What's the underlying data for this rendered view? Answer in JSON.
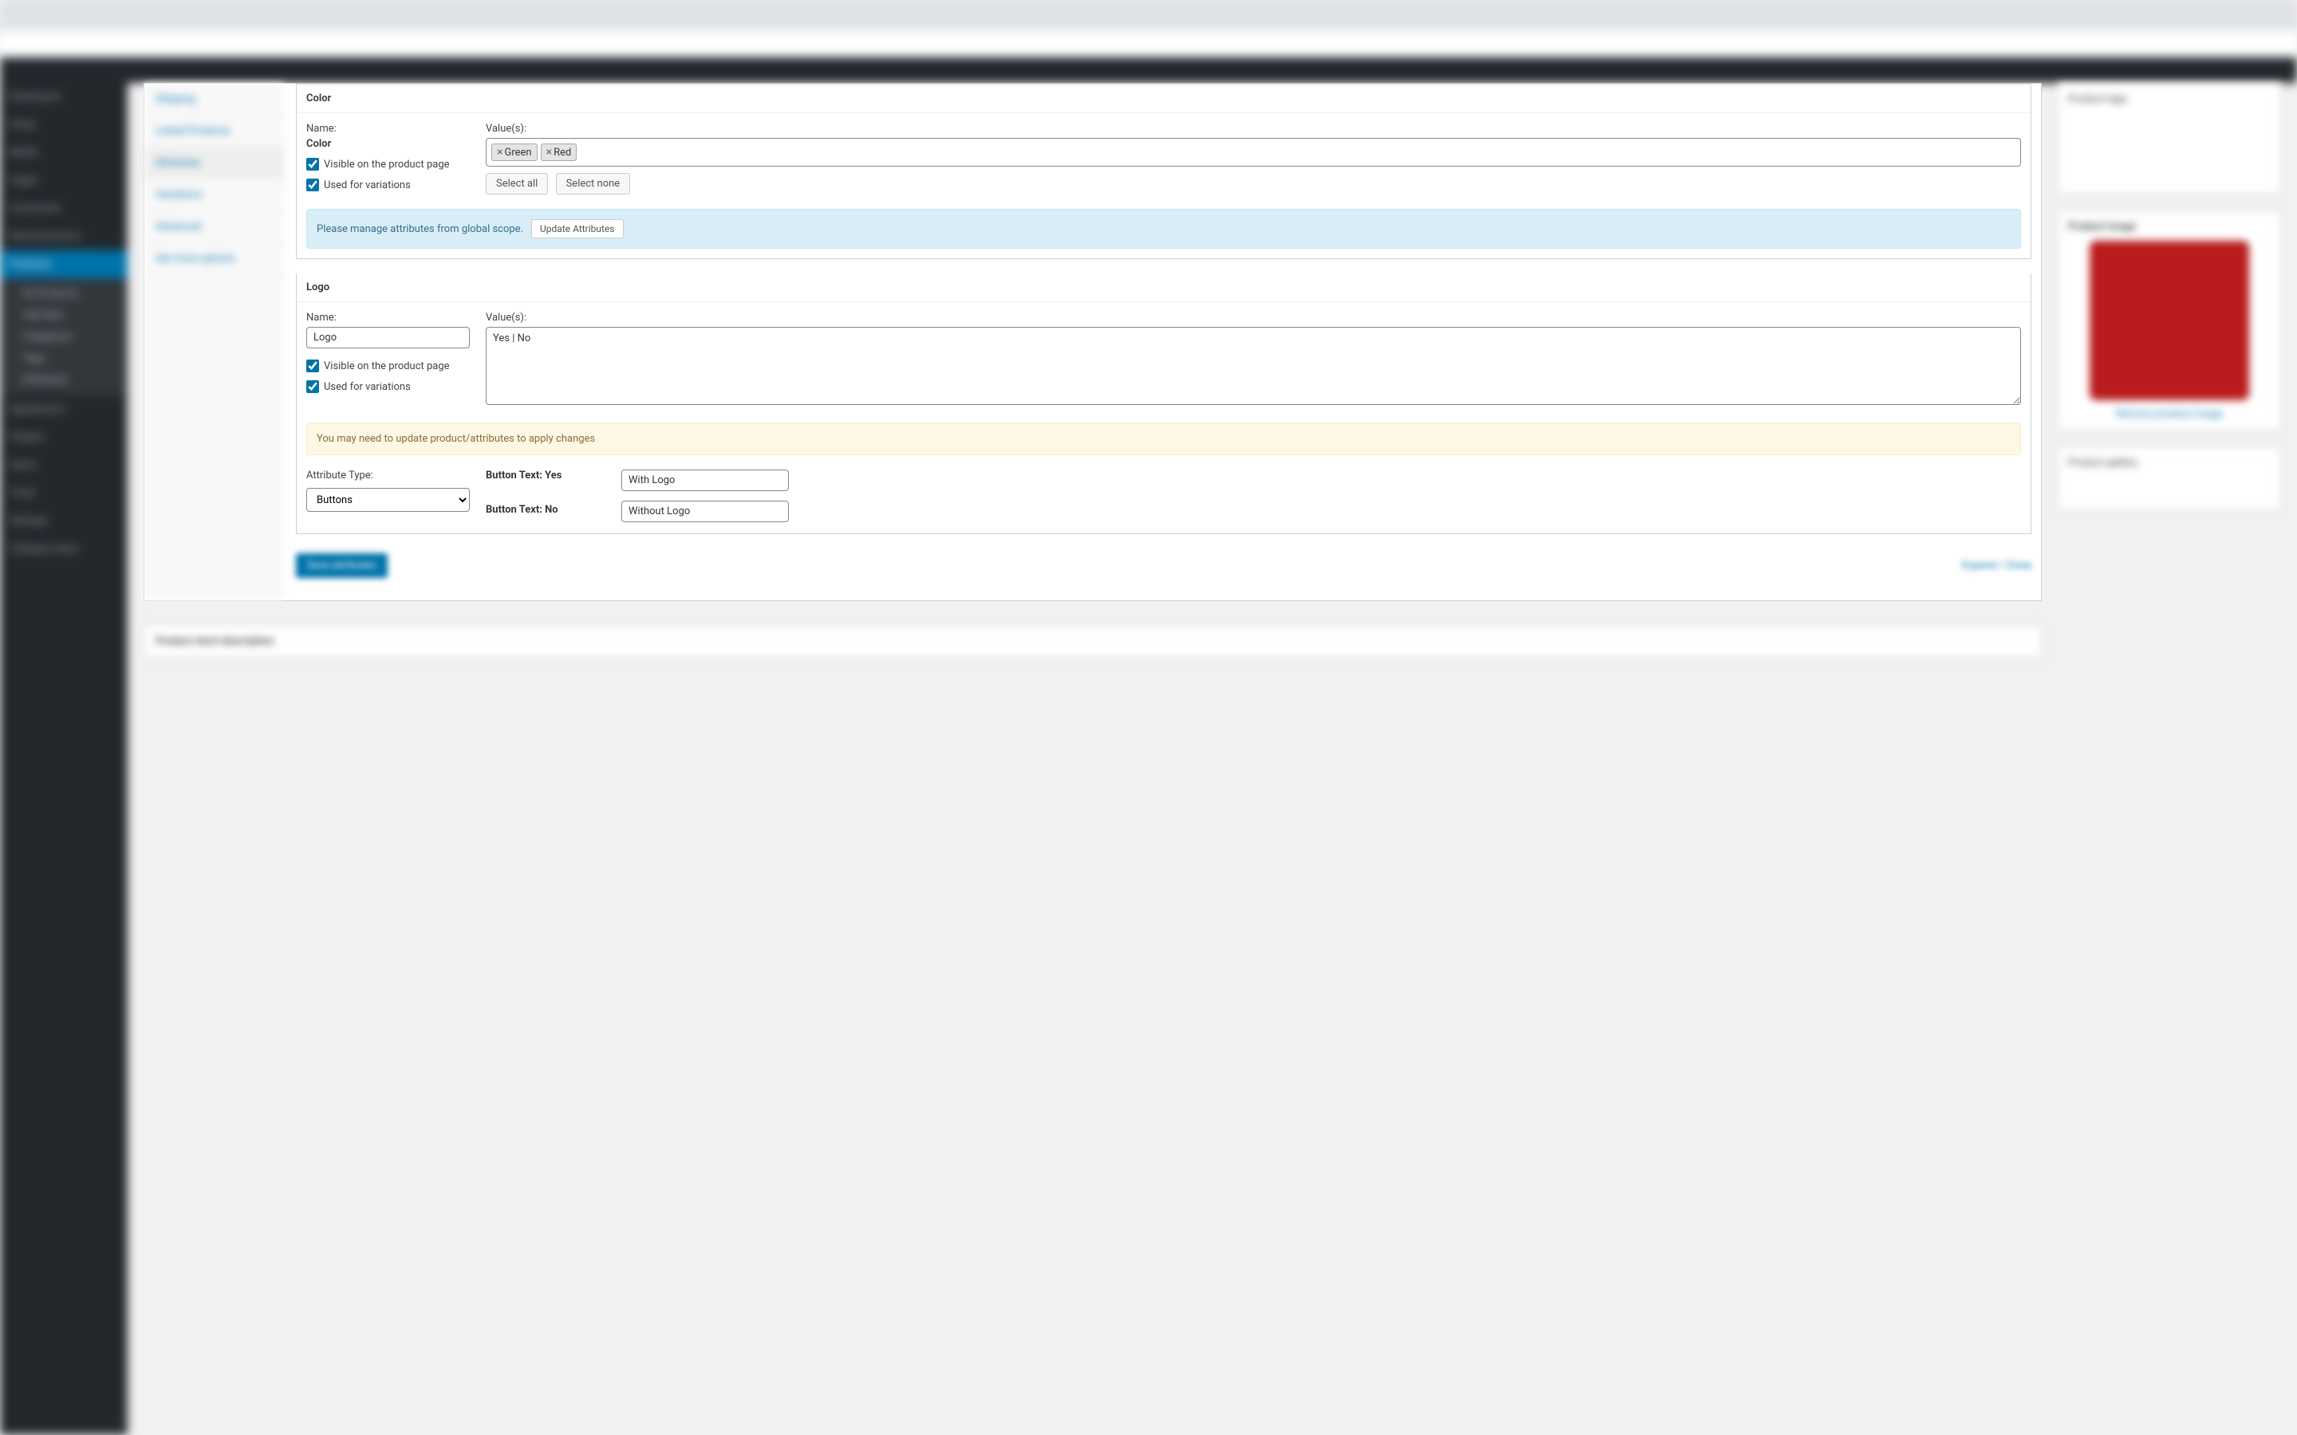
{
  "attributes": {
    "color": {
      "title": "Color",
      "name_label": "Name:",
      "name_value": "Color",
      "values_label": "Value(s):",
      "tags": [
        "Green",
        "Red"
      ],
      "select_all": "Select all",
      "select_none": "Select none",
      "visible_label": "Visible on the product page",
      "visible_checked": true,
      "variations_label": "Used for variations",
      "variations_checked": true,
      "info_message": "Please manage attributes from global scope.",
      "update_button": "Update Attributes"
    },
    "logo": {
      "title": "Logo",
      "name_label": "Name:",
      "name_value": "Logo",
      "values_label": "Value(s):",
      "values_text": "Yes | No",
      "visible_label": "Visible on the product page",
      "visible_checked": true,
      "variations_label": "Used for variations",
      "variations_checked": true,
      "warn_message": "You may need to update product/attributes to apply changes",
      "type_label": "Attribute Type:",
      "type_value": "Buttons",
      "btn_text_yes_label": "Button Text: Yes",
      "btn_text_yes_value": "With Logo",
      "btn_text_no_label": "Button Text: No",
      "btn_text_no_value": "Without Logo"
    }
  },
  "footer": {
    "save": "Save attributes",
    "expand": "Expand / Close"
  },
  "short_desc": "Product short description"
}
